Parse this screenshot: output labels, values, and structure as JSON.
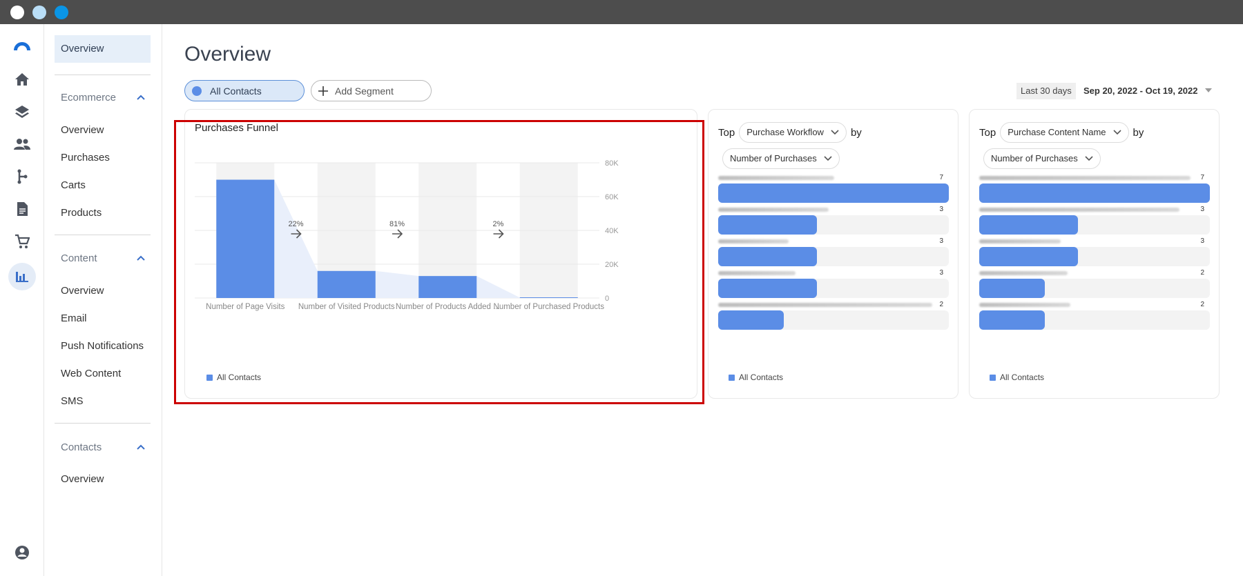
{
  "window": {
    "dots": [
      "#ffffff",
      "#b9def7",
      "#0a95e6"
    ]
  },
  "rail": {
    "icons": [
      "logo-icon",
      "home-icon",
      "layers-icon",
      "people-icon",
      "branch-icon",
      "document-icon",
      "cart-icon",
      "chart-icon",
      "account-icon"
    ],
    "active": "chart-icon"
  },
  "subnav": {
    "top_item": "Overview",
    "ecommerce": {
      "header": "Ecommerce",
      "items": [
        "Overview",
        "Purchases",
        "Carts",
        "Products"
      ]
    },
    "content": {
      "header": "Content",
      "items": [
        "Overview",
        "Email",
        "Push Notifications",
        "Web Content",
        "SMS"
      ]
    },
    "contacts": {
      "header": "Contacts",
      "items": [
        "Overview"
      ]
    }
  },
  "page": {
    "title": "Overview",
    "segments": {
      "active_label": "All Contacts",
      "add_label": "Add Segment"
    },
    "date_range": {
      "preset": "Last 30 days",
      "value": "Sep 20, 2022 - Oct 19, 2022"
    }
  },
  "funnel_card": {
    "title": "Purchases Funnel",
    "legend": "All Contacts"
  },
  "workflow_card": {
    "top_label": "Top",
    "dimension": "Purchase Workflow",
    "by_label": "by",
    "metric": "Number of Purchases",
    "legend": "All Contacts",
    "rows": [
      {
        "value": 7
      },
      {
        "value": 3
      },
      {
        "value": 3
      },
      {
        "value": 3
      },
      {
        "value": 2
      }
    ]
  },
  "content_card": {
    "top_label": "Top",
    "dimension": "Purchase Content Name",
    "by_label": "by",
    "metric": "Number of Purchases",
    "legend": "All Contacts",
    "rows": [
      {
        "value": 7
      },
      {
        "value": 3
      },
      {
        "value": 3
      },
      {
        "value": 2
      },
      {
        "value": 2
      }
    ]
  },
  "chart_data": {
    "type": "bar",
    "title": "Purchases Funnel",
    "categories": [
      "Number of Page Visits",
      "Number of Visited Products",
      "Number of Products Added ...",
      "Number of Purchased Products"
    ],
    "series": [
      {
        "name": "All Contacts",
        "values": [
          70000,
          16000,
          13000,
          260
        ]
      }
    ],
    "step_rates": [
      "22%",
      "81%",
      "2%"
    ],
    "y_ticks": [
      "0",
      "20K",
      "40K",
      "60K",
      "80K"
    ],
    "ylim": [
      0,
      80000
    ],
    "grid": true,
    "color": "#5b8de6"
  }
}
